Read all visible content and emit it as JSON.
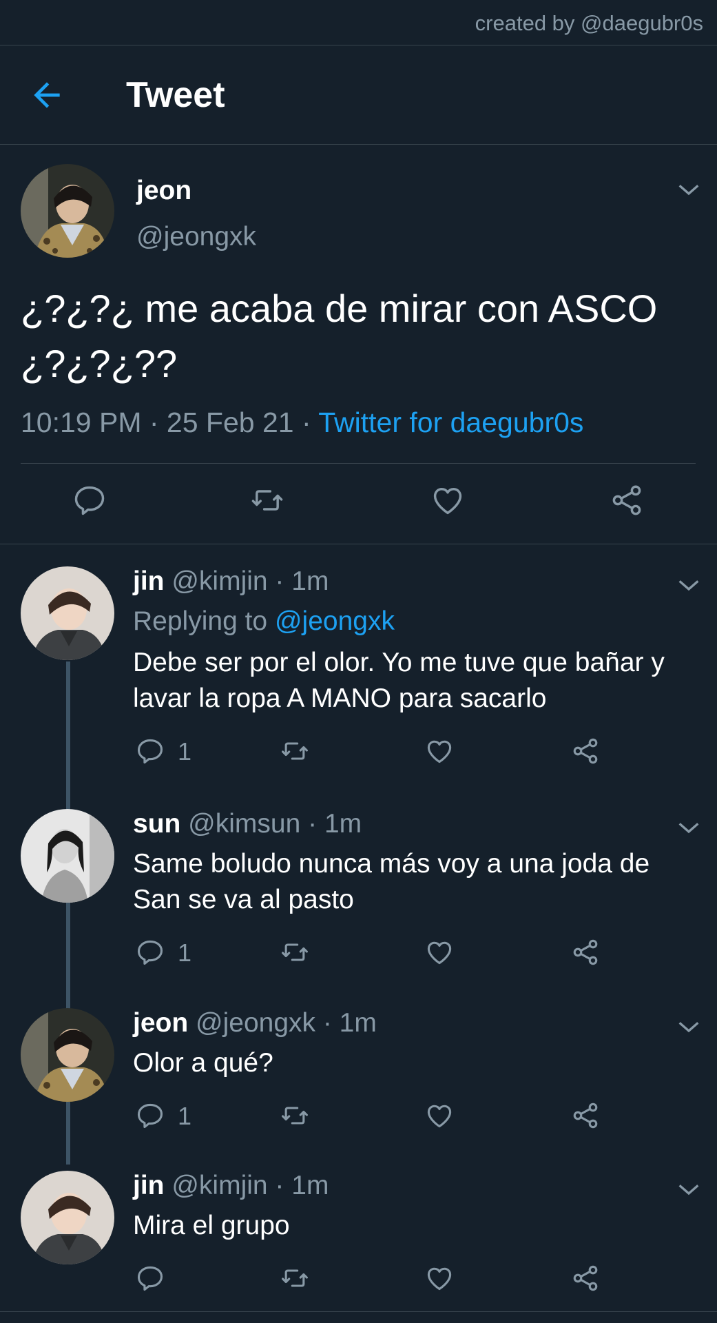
{
  "credit": "created by @daegubr0s",
  "header": {
    "title": "Tweet",
    "back_icon": "arrow-left-icon"
  },
  "colors": {
    "background": "#15202b",
    "accent": "#1da1f2",
    "muted": "#8899a6",
    "divider": "#38444d"
  },
  "main_tweet": {
    "name": "jeon",
    "handle": "@jeongxk",
    "text": "¿?¿?¿ me acaba de mirar con ASCO ¿?¿?¿??",
    "time": "10:19 PM · 25 Feb 21 · ",
    "source": "Twitter for daegubr0s",
    "actions": [
      "reply-icon",
      "retweet-icon",
      "like-icon",
      "share-icon"
    ]
  },
  "replies": [
    {
      "name": "jin",
      "meta": " @kimjin · 1m",
      "replying_prefix": "Replying to ",
      "replying_to": "@jeongxk",
      "text": "Debe ser por el olor. Yo me tuve que bañar y lavar la ropa A MANO para sacarlo",
      "reply_count": "1"
    },
    {
      "name": "sun",
      "meta": " @kimsun · 1m",
      "text": "Same boludo nunca más voy a una joda de San se va al pasto",
      "reply_count": "1"
    },
    {
      "name": "jeon",
      "meta": " @jeongxk · 1m",
      "text": "Olor a qué?",
      "reply_count": "1"
    },
    {
      "name": "jin",
      "meta": " @kimjin · 1m",
      "text": "Mira el grupo",
      "reply_count": ""
    }
  ]
}
